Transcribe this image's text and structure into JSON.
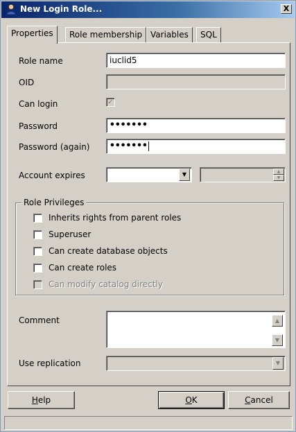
{
  "window": {
    "title": "New Login Role...",
    "close_label": "X"
  },
  "tabs": [
    {
      "label": "Properties"
    },
    {
      "label": "Role membership"
    },
    {
      "label": "Variables"
    },
    {
      "label": "SQL"
    }
  ],
  "form": {
    "role_name_label": "Role name",
    "role_name_value": "iuclid5",
    "oid_label": "OID",
    "oid_value": "",
    "can_login_label": "Can login",
    "can_login_checked": true,
    "password_label": "Password",
    "password_value": "•••••••",
    "password_again_label": "Password (again)",
    "password_again_value": "•••••••",
    "account_expires_label": "Account expires",
    "account_expires_value": "",
    "account_expires_time": ""
  },
  "privileges": {
    "title": "Role Privileges",
    "items": [
      {
        "label": "Inherits rights from parent roles",
        "checked": false,
        "enabled": true
      },
      {
        "label": "Superuser",
        "checked": false,
        "enabled": true
      },
      {
        "label": "Can create database objects",
        "checked": false,
        "enabled": true
      },
      {
        "label": "Can create roles",
        "checked": false,
        "enabled": true
      },
      {
        "label": "Can modify catalog directly",
        "checked": false,
        "enabled": false
      }
    ]
  },
  "comment": {
    "label": "Comment",
    "value": ""
  },
  "replication": {
    "label": "Use replication",
    "value": ""
  },
  "buttons": {
    "help_mnemonic": "H",
    "help_rest": "elp",
    "ok_mnemonic": "O",
    "ok_rest": "K",
    "cancel_mnemonic": "C",
    "cancel_rest": "ancel"
  },
  "status": {
    "text": ""
  },
  "icons": {
    "title": "user-icon",
    "close": "close-icon",
    "checkmark": "checkmark-icon",
    "dropdown": "chevron-down-icon"
  }
}
